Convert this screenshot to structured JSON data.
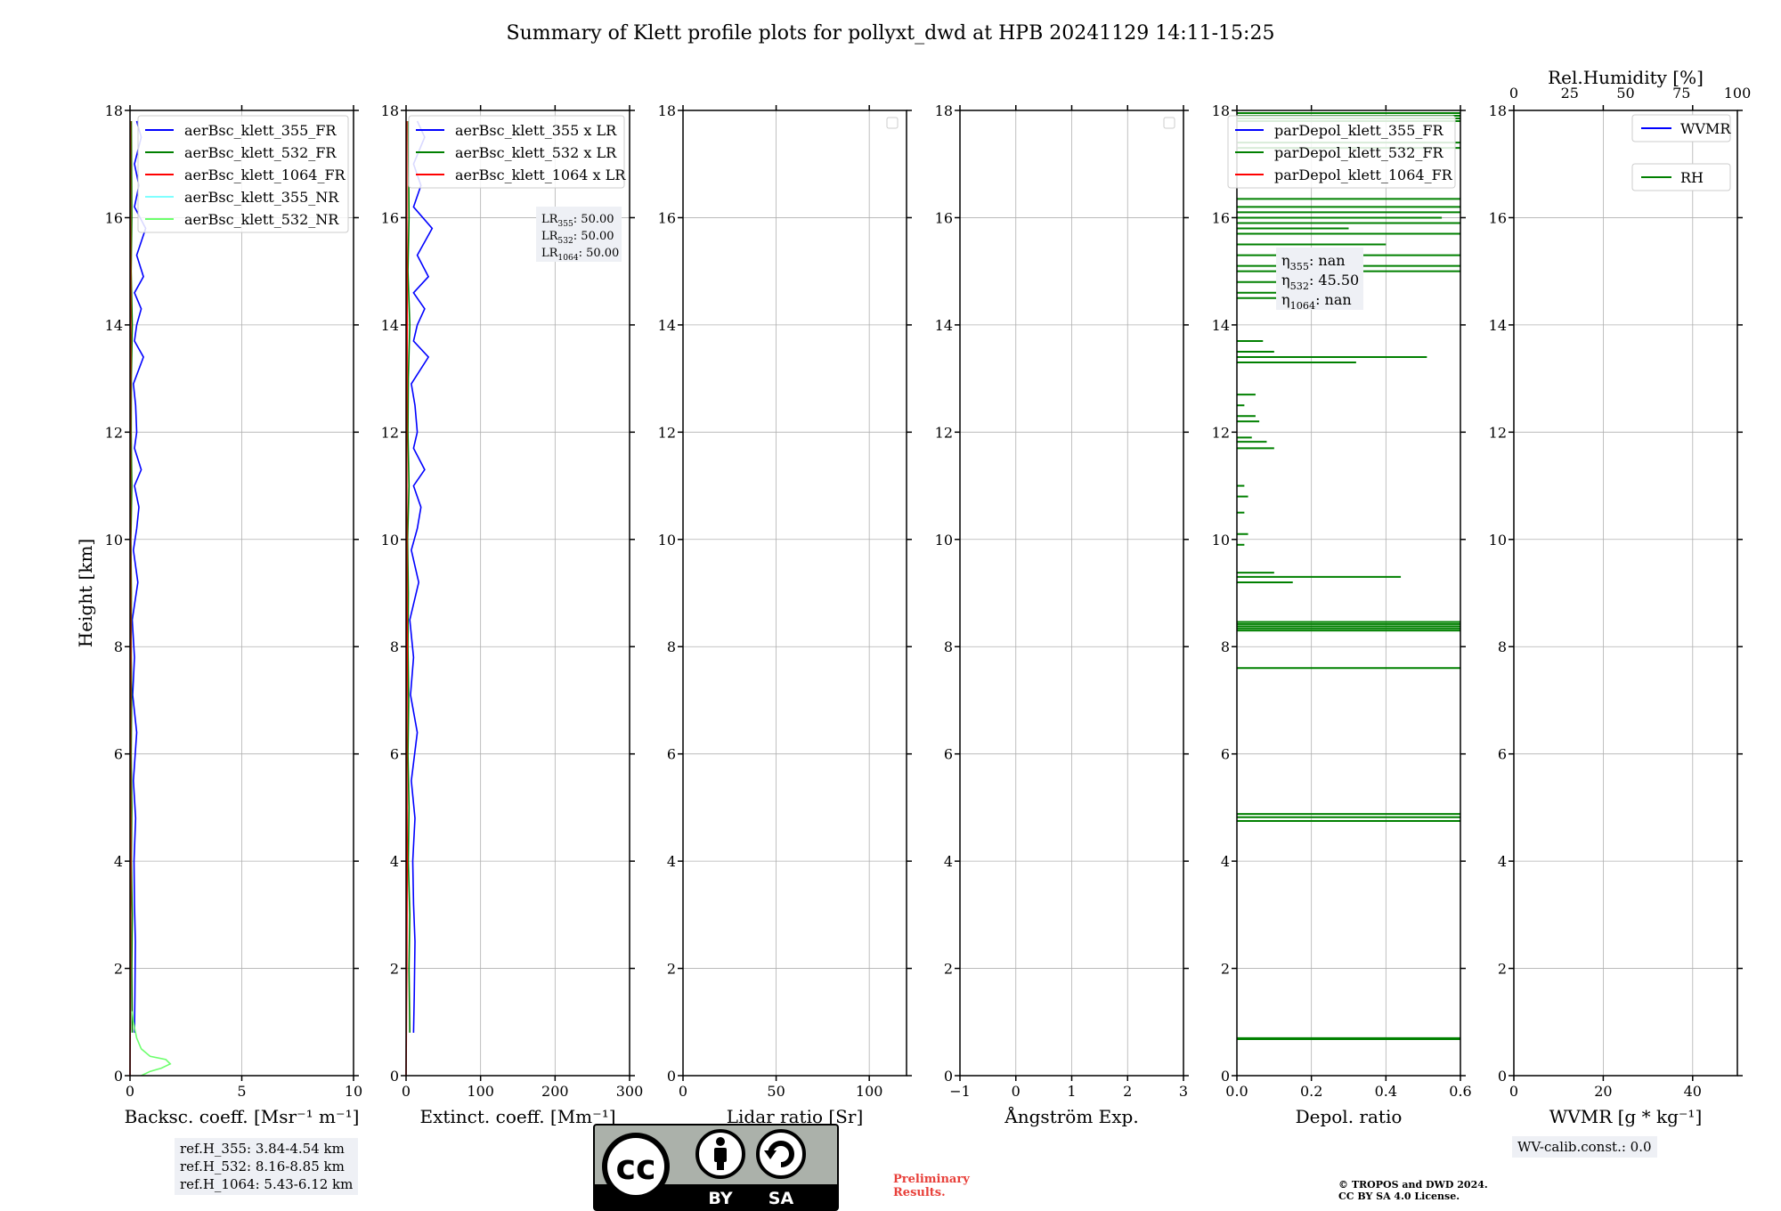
{
  "title": "Summary of Klett profile plots for pollyxt_dwd at HPB 20241129 14:11-15:25",
  "chart_data": [
    {
      "type": "line",
      "xlabel": "Backsc. coeff. [Msr⁻¹ m⁻¹]",
      "ylabel": "Height [km]",
      "xlim": [
        0,
        10
      ],
      "ylim": [
        0,
        18
      ],
      "xticks": [
        "0",
        "5",
        "10"
      ],
      "yticks": [
        "0",
        "2",
        "4",
        "6",
        "8",
        "10",
        "12",
        "14",
        "16",
        "18"
      ],
      "grid": true,
      "legend": "top-right",
      "series": [
        {
          "name": "aerBsc_klett_355_FR",
          "color": "#0000ff",
          "x": [
            0.2,
            0.22,
            0.24,
            0.2,
            0.18,
            0.25,
            0.15,
            0.3,
            0.12,
            0.2,
            0.1,
            0.35,
            0.15,
            0.3,
            0.4,
            0.2,
            0.5,
            0.2,
            0.3,
            0.25,
            0.15,
            0.6,
            0.2,
            0.3,
            0.5,
            0.2,
            0.6,
            0.3,
            0.7,
            0.2,
            0.4,
            0.2,
            0.5,
            0.3
          ],
          "y": [
            0.8,
            1.5,
            2.5,
            3.2,
            4.0,
            4.8,
            5.5,
            6.4,
            7.1,
            7.8,
            8.5,
            9.2,
            9.8,
            10.2,
            10.6,
            11.0,
            11.3,
            11.7,
            12.0,
            12.5,
            12.9,
            13.4,
            13.7,
            14.0,
            14.3,
            14.6,
            14.9,
            15.3,
            15.8,
            16.2,
            16.6,
            17.0,
            17.5,
            17.8
          ]
        },
        {
          "name": "aerBsc_klett_532_FR",
          "color": "#008000",
          "x": [
            0.1,
            0.08,
            0.1,
            0.06,
            0.08,
            0.05,
            0.07,
            0.05,
            0.06,
            0.04,
            0.08,
            0.05,
            0.06,
            0.1,
            0.05,
            0.08,
            0.06
          ],
          "y": [
            0.8,
            2,
            3,
            4,
            5,
            6,
            7,
            8,
            9,
            10,
            11,
            12,
            13,
            14,
            15,
            16,
            17.8
          ]
        },
        {
          "name": "aerBsc_klett_1064_FR",
          "color": "#ff0000",
          "x": [
            0.0,
            0.02,
            0.03,
            0.02,
            0.03,
            0.02,
            0.02,
            0.03,
            0.02,
            0.02
          ],
          "y": [
            0.0,
            2,
            4,
            6,
            8,
            10,
            12,
            14,
            16,
            17.8
          ]
        },
        {
          "name": "aerBsc_klett_355_NR",
          "color": "#7fffff",
          "x": [],
          "y": []
        },
        {
          "name": "aerBsc_klett_532_NR",
          "color": "#6cff6c",
          "x": [
            0.5,
            0.9,
            1.4,
            1.8,
            1.6,
            0.9,
            0.5,
            0.3,
            0.2,
            0.15,
            0.1
          ],
          "y": [
            0.0,
            0.08,
            0.14,
            0.22,
            0.3,
            0.36,
            0.5,
            0.7,
            0.9,
            1.0,
            1.2
          ]
        }
      ],
      "annotation": {
        "lines": [
          "ref.H_355: 3.84-4.54 km",
          "ref.H_532: 8.16-8.85 km",
          "ref.H_1064: 5.43-6.12 km"
        ]
      }
    },
    {
      "type": "line",
      "xlabel": "Extinct. coeff. [Mm⁻¹]",
      "xlim": [
        0,
        300
      ],
      "ylim": [
        0,
        18
      ],
      "xticks": [
        "0",
        "100",
        "200",
        "300"
      ],
      "yticks": [
        "0",
        "2",
        "4",
        "6",
        "8",
        "10",
        "12",
        "14",
        "16",
        "18"
      ],
      "grid": true,
      "legend": "top-right",
      "series": [
        {
          "name": "aerBsc_klett_355 x LR",
          "color": "#0000ff",
          "x": [
            10,
            11,
            12,
            10,
            9,
            12,
            7,
            15,
            6,
            10,
            5,
            17,
            7,
            15,
            20,
            10,
            25,
            10,
            15,
            12,
            7,
            30,
            10,
            15,
            25,
            10,
            30,
            15,
            35,
            10,
            20,
            10,
            25,
            15
          ],
          "y": [
            0.8,
            1.5,
            2.5,
            3.2,
            4.0,
            4.8,
            5.5,
            6.4,
            7.1,
            7.8,
            8.5,
            9.2,
            9.8,
            10.2,
            10.6,
            11.0,
            11.3,
            11.7,
            12.0,
            12.5,
            12.9,
            13.4,
            13.7,
            14.0,
            14.3,
            14.6,
            14.9,
            15.3,
            15.8,
            16.2,
            16.6,
            17.0,
            17.5,
            17.8
          ]
        },
        {
          "name": "aerBsc_klett_532 x LR",
          "color": "#008000",
          "x": [
            5,
            4,
            5,
            3,
            4,
            2.5,
            3.5,
            2.5,
            3,
            2,
            4,
            2.5,
            3,
            5,
            2.5,
            4,
            3
          ],
          "y": [
            0.8,
            2,
            3,
            4,
            5,
            6,
            7,
            8,
            9,
            10,
            11,
            12,
            13,
            14,
            15,
            16,
            17.8
          ]
        },
        {
          "name": "aerBsc_klett_1064 x LR",
          "color": "#ff0000",
          "x": [
            0,
            1,
            1.5,
            1,
            1.5,
            1,
            1,
            1.5,
            1,
            1
          ],
          "y": [
            0.0,
            2,
            4,
            6,
            8,
            10,
            12,
            14,
            16,
            17.8
          ]
        }
      ],
      "annotation": {
        "lines": [
          [
            "LR",
            "355",
            ": 50.00"
          ],
          [
            "LR",
            "532",
            ": 50.00"
          ],
          [
            "LR",
            "1064",
            ": 50.00"
          ]
        ]
      }
    },
    {
      "type": "line",
      "xlabel": "Lidar ratio [Sr]",
      "xlim": [
        0,
        120
      ],
      "ylim": [
        0,
        18
      ],
      "xticks": [
        "0",
        "50",
        "100"
      ],
      "yticks": [
        "0",
        "2",
        "4",
        "6",
        "8",
        "10",
        "12",
        "14",
        "16",
        "18"
      ],
      "grid": true,
      "legend": "top-right",
      "series": []
    },
    {
      "type": "line",
      "xlabel": "Ångström Exp.",
      "xlim": [
        -1,
        3
      ],
      "ylim": [
        0,
        18
      ],
      "xticks": [
        "−1",
        "0",
        "1",
        "2",
        "3"
      ],
      "yticks": [
        "0",
        "2",
        "4",
        "6",
        "8",
        "10",
        "12",
        "14",
        "16",
        "18"
      ],
      "grid": true,
      "legend": "top-right",
      "series": []
    },
    {
      "type": "line",
      "xlabel": "Depol. ratio",
      "xlim": [
        0,
        0.6
      ],
      "ylim": [
        0,
        18
      ],
      "xticks": [
        "0.0",
        "0.2",
        "0.4",
        "0.6"
      ],
      "yticks": [
        "0",
        "2",
        "4",
        "6",
        "8",
        "10",
        "12",
        "14",
        "16",
        "18"
      ],
      "grid": true,
      "legend": "top-right",
      "series": [
        {
          "name": "parDepol_klett_355_FR",
          "color": "#0000ff",
          "x": [],
          "y": []
        },
        {
          "name": "parDepol_klett_532_FR",
          "color": "#008000",
          "x": [],
          "y": []
        },
        {
          "name": "parDepol_klett_1064_FR",
          "color": "#ff0000",
          "x": [],
          "y": []
        }
      ],
      "spikes_532": [
        [
          0.68,
          0.6
        ],
        [
          0.7,
          0.6
        ],
        [
          4.75,
          0.6
        ],
        [
          4.82,
          0.6
        ],
        [
          4.88,
          0.6
        ],
        [
          7.6,
          0.6
        ],
        [
          8.3,
          0.6
        ],
        [
          8.34,
          0.6
        ],
        [
          8.38,
          0.6
        ],
        [
          8.42,
          0.6
        ],
        [
          8.46,
          0.6
        ],
        [
          9.2,
          0.15
        ],
        [
          9.3,
          0.44
        ],
        [
          9.38,
          0.1
        ],
        [
          9.9,
          0.02
        ],
        [
          10.1,
          0.03
        ],
        [
          10.5,
          0.02
        ],
        [
          10.8,
          0.03
        ],
        [
          11.0,
          0.02
        ],
        [
          11.7,
          0.1
        ],
        [
          11.82,
          0.08
        ],
        [
          11.9,
          0.04
        ],
        [
          12.2,
          0.06
        ],
        [
          12.3,
          0.05
        ],
        [
          12.5,
          0.02
        ],
        [
          12.7,
          0.05
        ],
        [
          13.3,
          0.32
        ],
        [
          13.4,
          0.51
        ],
        [
          13.5,
          0.1
        ],
        [
          13.7,
          0.07
        ],
        [
          14.5,
          0.15
        ],
        [
          14.6,
          0.2
        ],
        [
          14.8,
          0.25
        ],
        [
          15.0,
          0.6
        ],
        [
          15.1,
          0.6
        ],
        [
          15.3,
          0.6
        ],
        [
          15.5,
          0.4
        ],
        [
          15.7,
          0.6
        ],
        [
          15.8,
          0.3
        ],
        [
          15.9,
          0.6
        ],
        [
          16.0,
          0.55
        ],
        [
          16.1,
          0.6
        ],
        [
          16.2,
          0.6
        ],
        [
          16.35,
          0.6
        ],
        [
          17.3,
          0.6
        ],
        [
          17.4,
          0.6
        ],
        [
          17.8,
          0.6
        ],
        [
          17.85,
          0.6
        ],
        [
          17.9,
          0.6
        ],
        [
          17.95,
          0.6
        ]
      ],
      "annotation": {
        "lines": [
          [
            "η",
            "355",
            ": nan"
          ],
          [
            "η",
            "532",
            ": 45.50"
          ],
          [
            "η",
            "1064",
            ": nan"
          ]
        ]
      }
    },
    {
      "type": "line",
      "xlabel": "WVMR [g * kg⁻¹]",
      "x2label": "Rel.Humidity [%]",
      "xlim": [
        0,
        50
      ],
      "x2lim": [
        0,
        100
      ],
      "ylim": [
        0,
        18
      ],
      "xticks": [
        "0",
        "20",
        "40"
      ],
      "x2ticks": [
        "0",
        "25",
        "50",
        "75",
        "100"
      ],
      "yticks": [
        "0",
        "2",
        "4",
        "6",
        "8",
        "10",
        "12",
        "14",
        "16",
        "18"
      ],
      "grid": true,
      "legend": "top-right",
      "series": [
        {
          "name": "WVMR",
          "color": "#0000ff",
          "x": [],
          "y": []
        },
        {
          "name": "RH",
          "color": "#008000",
          "x": [],
          "y": []
        }
      ],
      "annotation": {
        "lines": [
          "WV-calib.const.: 0.0"
        ]
      }
    }
  ],
  "footer": {
    "preliminary": [
      "Preliminary",
      "Results."
    ],
    "copyright": [
      "© TROPOS and DWD 2024.",
      "CC BY SA 4.0 License."
    ],
    "badge": {
      "cc": "cc",
      "by": "BY",
      "sa": "SA"
    }
  }
}
